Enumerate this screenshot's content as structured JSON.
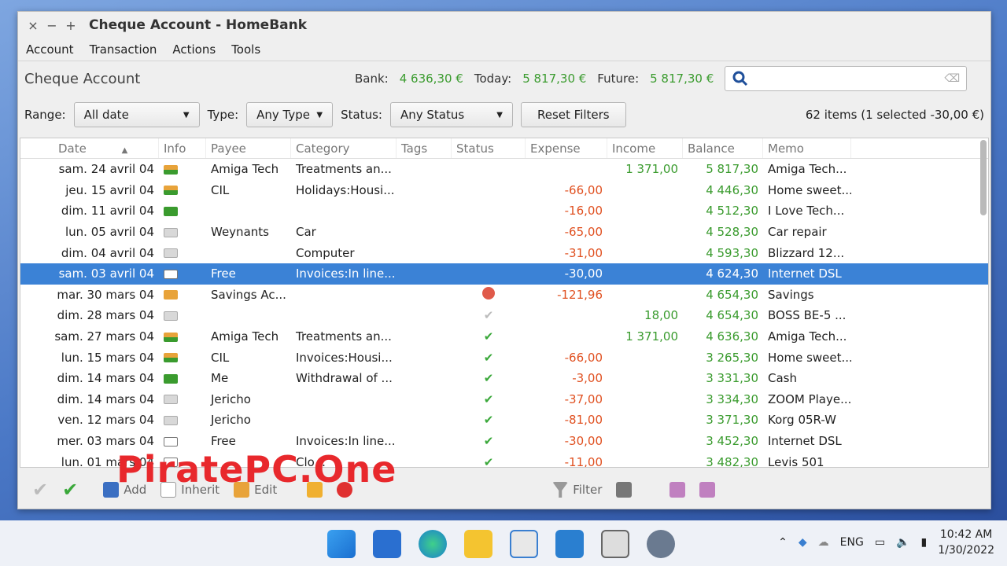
{
  "window": {
    "controls": [
      "×",
      "−",
      "+"
    ],
    "title": "Cheque Account - HomeBank"
  },
  "menu": [
    "Account",
    "Transaction",
    "Actions",
    "Tools"
  ],
  "account": {
    "name": "Cheque Account",
    "bank_label": "Bank:",
    "bank_value": "4 636,30 €",
    "today_label": "Today:",
    "today_value": "5 817,30 €",
    "future_label": "Future:",
    "future_value": "5 817,30 €"
  },
  "search": {
    "placeholder": ""
  },
  "filters": {
    "range_label": "Range:",
    "range_value": "All date",
    "type_label": "Type:",
    "type_value": "Any Type",
    "status_label": "Status:",
    "status_value": "Any Status",
    "reset_label": "Reset Filters",
    "items_count": "62 items (1 selected -30,00 €)"
  },
  "columns": [
    "Date",
    "Info",
    "Payee",
    "Category",
    "Tags",
    "Status",
    "Expense",
    "Income",
    "Balance",
    "Memo"
  ],
  "rows": [
    {
      "date": "sam. 24 avril 04",
      "info": "xfer",
      "payee": "Amiga Tech",
      "category": "Treatments an...",
      "status": "",
      "expense": "",
      "income": "1 371,00",
      "balance": "5 817,30",
      "memo": "Amiga Tech..."
    },
    {
      "date": "jeu. 15 avril 04",
      "info": "xfer",
      "payee": "CIL",
      "category": "Holidays:Housi...",
      "status": "",
      "expense": "-66,00",
      "income": "",
      "balance": "4 446,30",
      "memo": "Home sweet..."
    },
    {
      "date": "dim. 11 avril 04",
      "info": "cash",
      "payee": "",
      "category": "",
      "status": "",
      "expense": "-16,00",
      "income": "",
      "balance": "4 512,30",
      "memo": "I Love Tech..."
    },
    {
      "date": "lun. 05 avril 04",
      "info": "doc",
      "payee": "Weynants",
      "category": "Car",
      "status": "",
      "expense": "-65,00",
      "income": "",
      "balance": "4 528,30",
      "memo": "Car repair"
    },
    {
      "date": "dim. 04 avril 04",
      "info": "doc",
      "payee": "",
      "category": "Computer",
      "status": "",
      "expense": "-31,00",
      "income": "",
      "balance": "4 593,30",
      "memo": "Blizzard 12..."
    },
    {
      "date": "sam. 03 avril 04",
      "info": "card",
      "payee": "Free",
      "category": "Invoices:In line...",
      "status": "",
      "expense": "-30,00",
      "income": "",
      "balance": "4 624,30",
      "memo": "Internet DSL",
      "selected": true
    },
    {
      "date": "mar. 30 mars 04",
      "info": "save",
      "payee": "Savings Ac...",
      "category": "",
      "status": "warn",
      "expense": "-121,96",
      "income": "",
      "balance": "4 654,30",
      "memo": "Savings"
    },
    {
      "date": "dim. 28 mars 04",
      "info": "doc",
      "payee": "",
      "category": "",
      "status": "grey",
      "expense": "",
      "income": "18,00",
      "balance": "4 654,30",
      "memo": "BOSS BE-5 ..."
    },
    {
      "date": "sam. 27 mars 04",
      "info": "xfer",
      "payee": "Amiga Tech",
      "category": "Treatments an...",
      "status": "check",
      "expense": "",
      "income": "1 371,00",
      "balance": "4 636,30",
      "memo": "Amiga Tech..."
    },
    {
      "date": "lun. 15 mars 04",
      "info": "xfer",
      "payee": "CIL",
      "category": "Invoices:Housi...",
      "status": "check",
      "expense": "-66,00",
      "income": "",
      "balance": "3 265,30",
      "memo": "Home sweet..."
    },
    {
      "date": "dim. 14 mars 04",
      "info": "cash",
      "payee": "Me",
      "category": "Withdrawal of ...",
      "status": "check",
      "expense": "-3,00",
      "income": "",
      "balance": "3 331,30",
      "memo": "Cash"
    },
    {
      "date": "dim. 14 mars 04",
      "info": "doc",
      "payee": "Jericho",
      "category": "",
      "status": "check",
      "expense": "-37,00",
      "income": "",
      "balance": "3 334,30",
      "memo": "ZOOM Playe..."
    },
    {
      "date": "ven. 12 mars 04",
      "info": "doc",
      "payee": "Jericho",
      "category": "",
      "status": "check",
      "expense": "-81,00",
      "income": "",
      "balance": "3 371,30",
      "memo": "Korg 05R-W"
    },
    {
      "date": "mer. 03 mars 04",
      "info": "card",
      "payee": "Free",
      "category": "Invoices:In line...",
      "status": "check",
      "expense": "-30,00",
      "income": "",
      "balance": "3 452,30",
      "memo": "Internet DSL"
    },
    {
      "date": "lun. 01 mars 04",
      "info": "card",
      "payee": "",
      "category": "Clo...",
      "status": "check",
      "expense": "-11,00",
      "income": "",
      "balance": "3 482,30",
      "memo": "Levis 501"
    }
  ],
  "toolbar": {
    "add": "Add",
    "inherit": "Inherit",
    "edit": "Edit",
    "filter": "Filter"
  },
  "watermark": "PiratePC.One",
  "taskbar": {
    "lang": "ENG",
    "time": "10:42 AM",
    "date": "1/30/2022"
  }
}
